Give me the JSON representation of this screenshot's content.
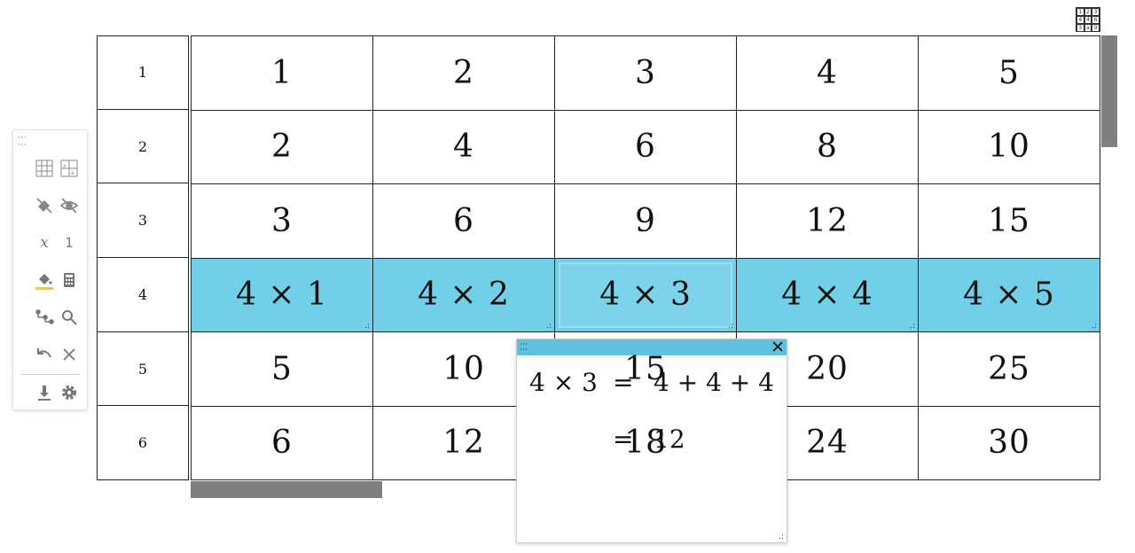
{
  "row_headers": [
    "1",
    "2",
    "3",
    "4",
    "5",
    "6"
  ],
  "table": [
    [
      "1",
      "2",
      "3",
      "4",
      "5"
    ],
    [
      "2",
      "4",
      "6",
      "8",
      "10"
    ],
    [
      "3",
      "6",
      "9",
      "12",
      "15"
    ],
    [
      "4 × 1",
      "4 × 2",
      "4 × 3",
      "4 × 4",
      "4 × 5"
    ],
    [
      "5",
      "10",
      "15",
      "20",
      "25"
    ],
    [
      "6",
      "12",
      "18",
      "24",
      "30"
    ]
  ],
  "highlight_row": 4,
  "selected_cell": "4 × 3",
  "app_icon_digits": [
    "1",
    "2",
    "3",
    "4",
    "4",
    "6",
    "3",
    "a",
    "9"
  ],
  "toolbar": {
    "variable_label": "x",
    "number_label": "1",
    "accent_color": "#e9c46a"
  },
  "popup": {
    "line1": {
      "lhs": "4 × 3",
      "eq": "=",
      "rhs": "4 + 4 + 4"
    },
    "line2": {
      "eq": "=",
      "rhs": "12"
    }
  },
  "colors": {
    "highlight": "#71cfe8",
    "popup_bar": "#5ec1dd",
    "scrollbar": "#7f7f7f"
  }
}
